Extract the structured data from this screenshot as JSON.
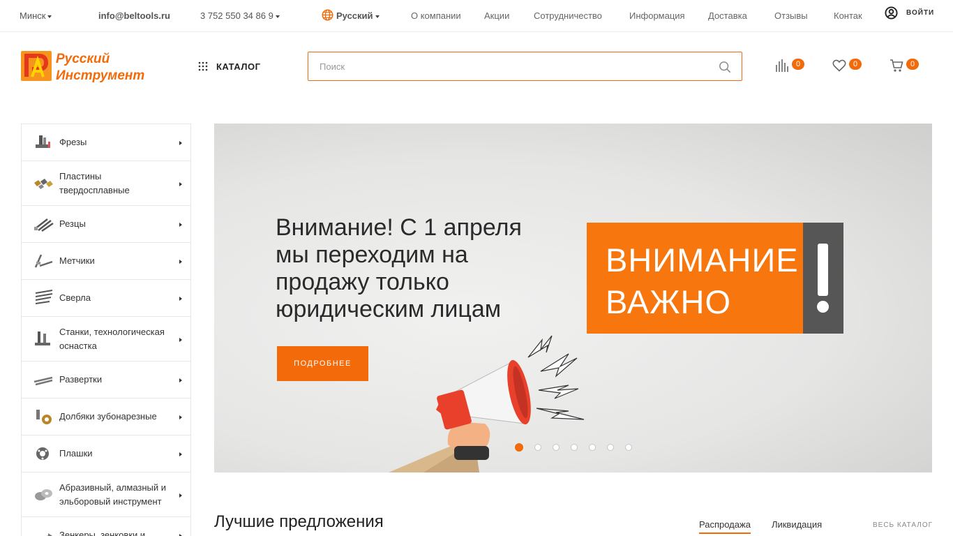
{
  "topbar": {
    "city": "Минск",
    "email": "info@beltools.ru",
    "phone": "3 752 550 34 86 9",
    "language": "Русский",
    "nav": [
      "О компании",
      "Акции",
      "Сотрудничество",
      "Информация",
      "Доставка",
      "Отзывы",
      "Контак"
    ],
    "login_label": "ВОЙТИ"
  },
  "header": {
    "logo_text_line1": "Русский",
    "logo_text_line2": "Инструмент",
    "catalog_label": "КАТАЛОГ",
    "search_placeholder": "Поиск",
    "compare_count": "0",
    "favorites_count": "0",
    "cart_count": "0"
  },
  "sidebar": {
    "categories": [
      {
        "label": "Фрезы",
        "icon": "milling-cutter-icon"
      },
      {
        "label": "Пластины твердосплавные",
        "icon": "carbide-inserts-icon"
      },
      {
        "label": "Резцы",
        "icon": "cutting-tools-icon"
      },
      {
        "label": "Метчики",
        "icon": "taps-icon"
      },
      {
        "label": "Сверла",
        "icon": "drills-icon"
      },
      {
        "label": "Станки, технологическая оснастка",
        "icon": "machine-tooling-icon"
      },
      {
        "label": "Развертки",
        "icon": "reamers-icon"
      },
      {
        "label": "Долбяки зубонарезные",
        "icon": "gear-shaper-icon"
      },
      {
        "label": "Плашки",
        "icon": "dies-icon"
      },
      {
        "label": "Абразивный, алмазный и эльборовый инструмент",
        "icon": "abrasive-icon"
      },
      {
        "label": "Зенкеры, зенковки и",
        "icon": "countersink-icon"
      }
    ]
  },
  "banner": {
    "headline": "Внимание! С 1 апреля мы переходим на продажу только юридическим лицам",
    "button_label": "ПОДРОБНЕЕ",
    "sign_line1": "ВНИМАНИЕ",
    "sign_line2": "ВАЖНО",
    "slide_count": 7,
    "active_slide": 1
  },
  "offers": {
    "title": "Лучшие предложения",
    "tabs": [
      "Распродажа",
      "Ликвидация"
    ],
    "all_catalog": "ВЕСЬ КАТАЛОГ"
  },
  "colors": {
    "accent": "#f26a0a",
    "sign_orange": "#f7760d",
    "sign_grey": "#565656"
  }
}
